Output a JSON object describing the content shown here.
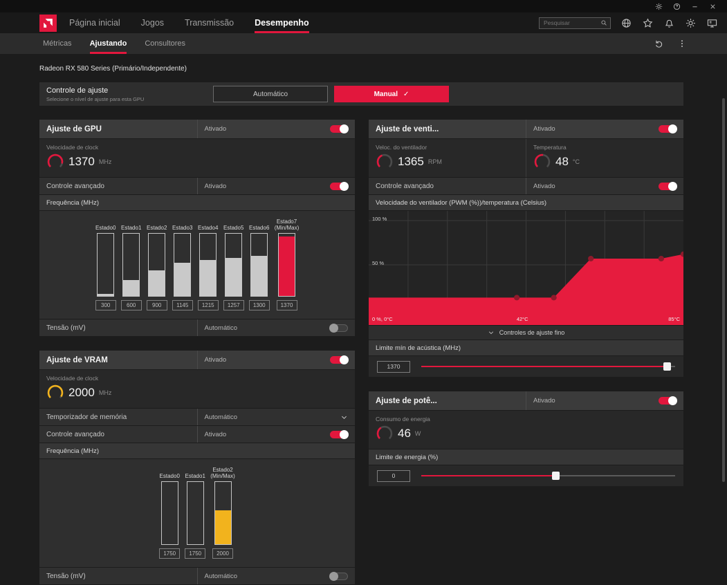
{
  "colors": {
    "accent": "#e2173d",
    "yellow": "#f2b31d",
    "chart_red": "#e61c3e",
    "dot": "#8e1a2b",
    "bar_grey": "#c9c9c9"
  },
  "titlebar": {
    "icons": [
      "settings-icon",
      "help-icon",
      "minimize-icon",
      "close-icon"
    ]
  },
  "nav": {
    "items": [
      {
        "label": "Página inicial",
        "active": false
      },
      {
        "label": "Jogos",
        "active": false
      },
      {
        "label": "Transmissão",
        "active": false
      },
      {
        "label": "Desempenho",
        "active": true
      }
    ],
    "search": {
      "placeholder": "Pesquisar"
    },
    "icons": [
      "globe-icon",
      "star-icon",
      "notifications-icon",
      "gear-icon",
      "display-icon"
    ]
  },
  "subnav": {
    "items": [
      {
        "label": "Métricas",
        "active": false
      },
      {
        "label": "Ajustando",
        "active": true
      },
      {
        "label": "Consultores",
        "active": false
      }
    ],
    "icons": [
      "undo-icon",
      "more-icon"
    ]
  },
  "device": {
    "name": "Radeon RX 580 Series (Primário/Independente)"
  },
  "tuning_control": {
    "title": "Controle de ajuste",
    "subtitle": "Selecione o nível de ajuste para esta GPU",
    "auto_label": "Automático",
    "manual_label": "Manual",
    "manual_check": "✓"
  },
  "gpu_tuning": {
    "title": "Ajuste de GPU",
    "status_label": "Ativado",
    "enabled": true,
    "clock": {
      "label": "Velocidade de clock",
      "value": "1370",
      "unit": "MHz",
      "gauge": {
        "fraction": 0.88,
        "color": "#e2173d"
      }
    },
    "advanced": {
      "label": "Controle avançado",
      "value": "Ativado",
      "enabled": true
    },
    "frequency_title": "Frequência (MHz)",
    "states": {
      "labels": [
        "Estado0",
        "Estado1",
        "Estado2",
        "Estado3",
        "Estado4",
        "Estado5",
        "Estado6",
        "Estado7"
      ],
      "sublabels": [
        "",
        "",
        "",
        "",
        "",
        "",
        "",
        "(Min/Max)"
      ],
      "values": [
        "300",
        "600",
        "900",
        "1145",
        "1215",
        "1257",
        "1300",
        "1370"
      ],
      "fills": [
        3,
        26,
        41,
        53,
        58,
        61,
        64,
        96
      ],
      "colors": [
        "#c9c9c9",
        "#c9c9c9",
        "#c9c9c9",
        "#c9c9c9",
        "#c9c9c9",
        "#c9c9c9",
        "#c9c9c9",
        "#e2173d"
      ]
    },
    "voltage": {
      "label": "Tensão (mV)",
      "value": "Automático",
      "enabled": false
    }
  },
  "vram_tuning": {
    "title": "Ajuste de VRAM",
    "status_label": "Ativado",
    "enabled": true,
    "clock": {
      "label": "Velocidade de clock",
      "value": "2000",
      "unit": "MHz",
      "gauge": {
        "fraction": 0.95,
        "color": "#f2b31d"
      }
    },
    "timing": {
      "label": "Temporizador de memória",
      "value": "Automático"
    },
    "advanced": {
      "label": "Controle avançado",
      "value": "Ativado",
      "enabled": true
    },
    "frequency_title": "Frequência (MHz)",
    "states": {
      "labels": [
        "Estado0",
        "Estado1",
        "Estado2"
      ],
      "sublabels": [
        "",
        "",
        "(Min/Max)"
      ],
      "values": [
        "1750",
        "1750",
        "2000"
      ],
      "fills": [
        0,
        0,
        55
      ],
      "colors": [
        "#c9c9c9",
        "#c9c9c9",
        "#f2b31d"
      ]
    },
    "voltage": {
      "label": "Tensão (mV)",
      "value": "Automático",
      "enabled": false
    }
  },
  "fan_tuning": {
    "title": "Ajuste de venti...",
    "status_label": "Ativado",
    "enabled": true,
    "fan_speed": {
      "label": "Veloc. do ventilador",
      "value": "1365",
      "unit": "RPM",
      "gauge": {
        "fraction": 0.42,
        "color": "#e2173d"
      }
    },
    "temperature": {
      "label": "Temperatura",
      "value": "48",
      "unit": "°C",
      "gauge": {
        "fraction": 0.52,
        "color": "#e2173d"
      }
    },
    "advanced": {
      "label": "Controle avançado",
      "value": "Ativado",
      "enabled": true
    },
    "chart": {
      "type": "area",
      "title": "Velocidade do ventilador (PWM (%))/temperatura (Celsius)",
      "y_max_label": "100 %",
      "y_mid_label": "50 %",
      "origin_label": "0 %, 0°C",
      "x_mid_label": "42°C",
      "x_max_label": "85°C",
      "temp_max": 85,
      "points": [
        [
          0,
          13
        ],
        [
          40,
          13
        ],
        [
          50,
          13
        ],
        [
          60,
          57
        ],
        [
          79,
          57
        ],
        [
          85,
          62
        ]
      ],
      "dots": [
        [
          40,
          13
        ],
        [
          50,
          13
        ],
        [
          60,
          57
        ],
        [
          79,
          57
        ],
        [
          85,
          62
        ]
      ]
    },
    "fine_controls_label": "Controles de ajuste fino",
    "acoustic": {
      "label": "Limite mín de acústica (MHz)",
      "value": "1370",
      "slider_pos": 0.97
    }
  },
  "power_tuning": {
    "title": "Ajuste de potê...",
    "status_label": "Ativado",
    "enabled": true,
    "power": {
      "label": "Consumo de energia",
      "value": "46",
      "unit": "W",
      "gauge": {
        "fraction": 0.38,
        "color": "#e2173d"
      }
    },
    "limit": {
      "label": "Limite de energia (%)",
      "value": "0",
      "slider_pos": 0.53
    }
  }
}
